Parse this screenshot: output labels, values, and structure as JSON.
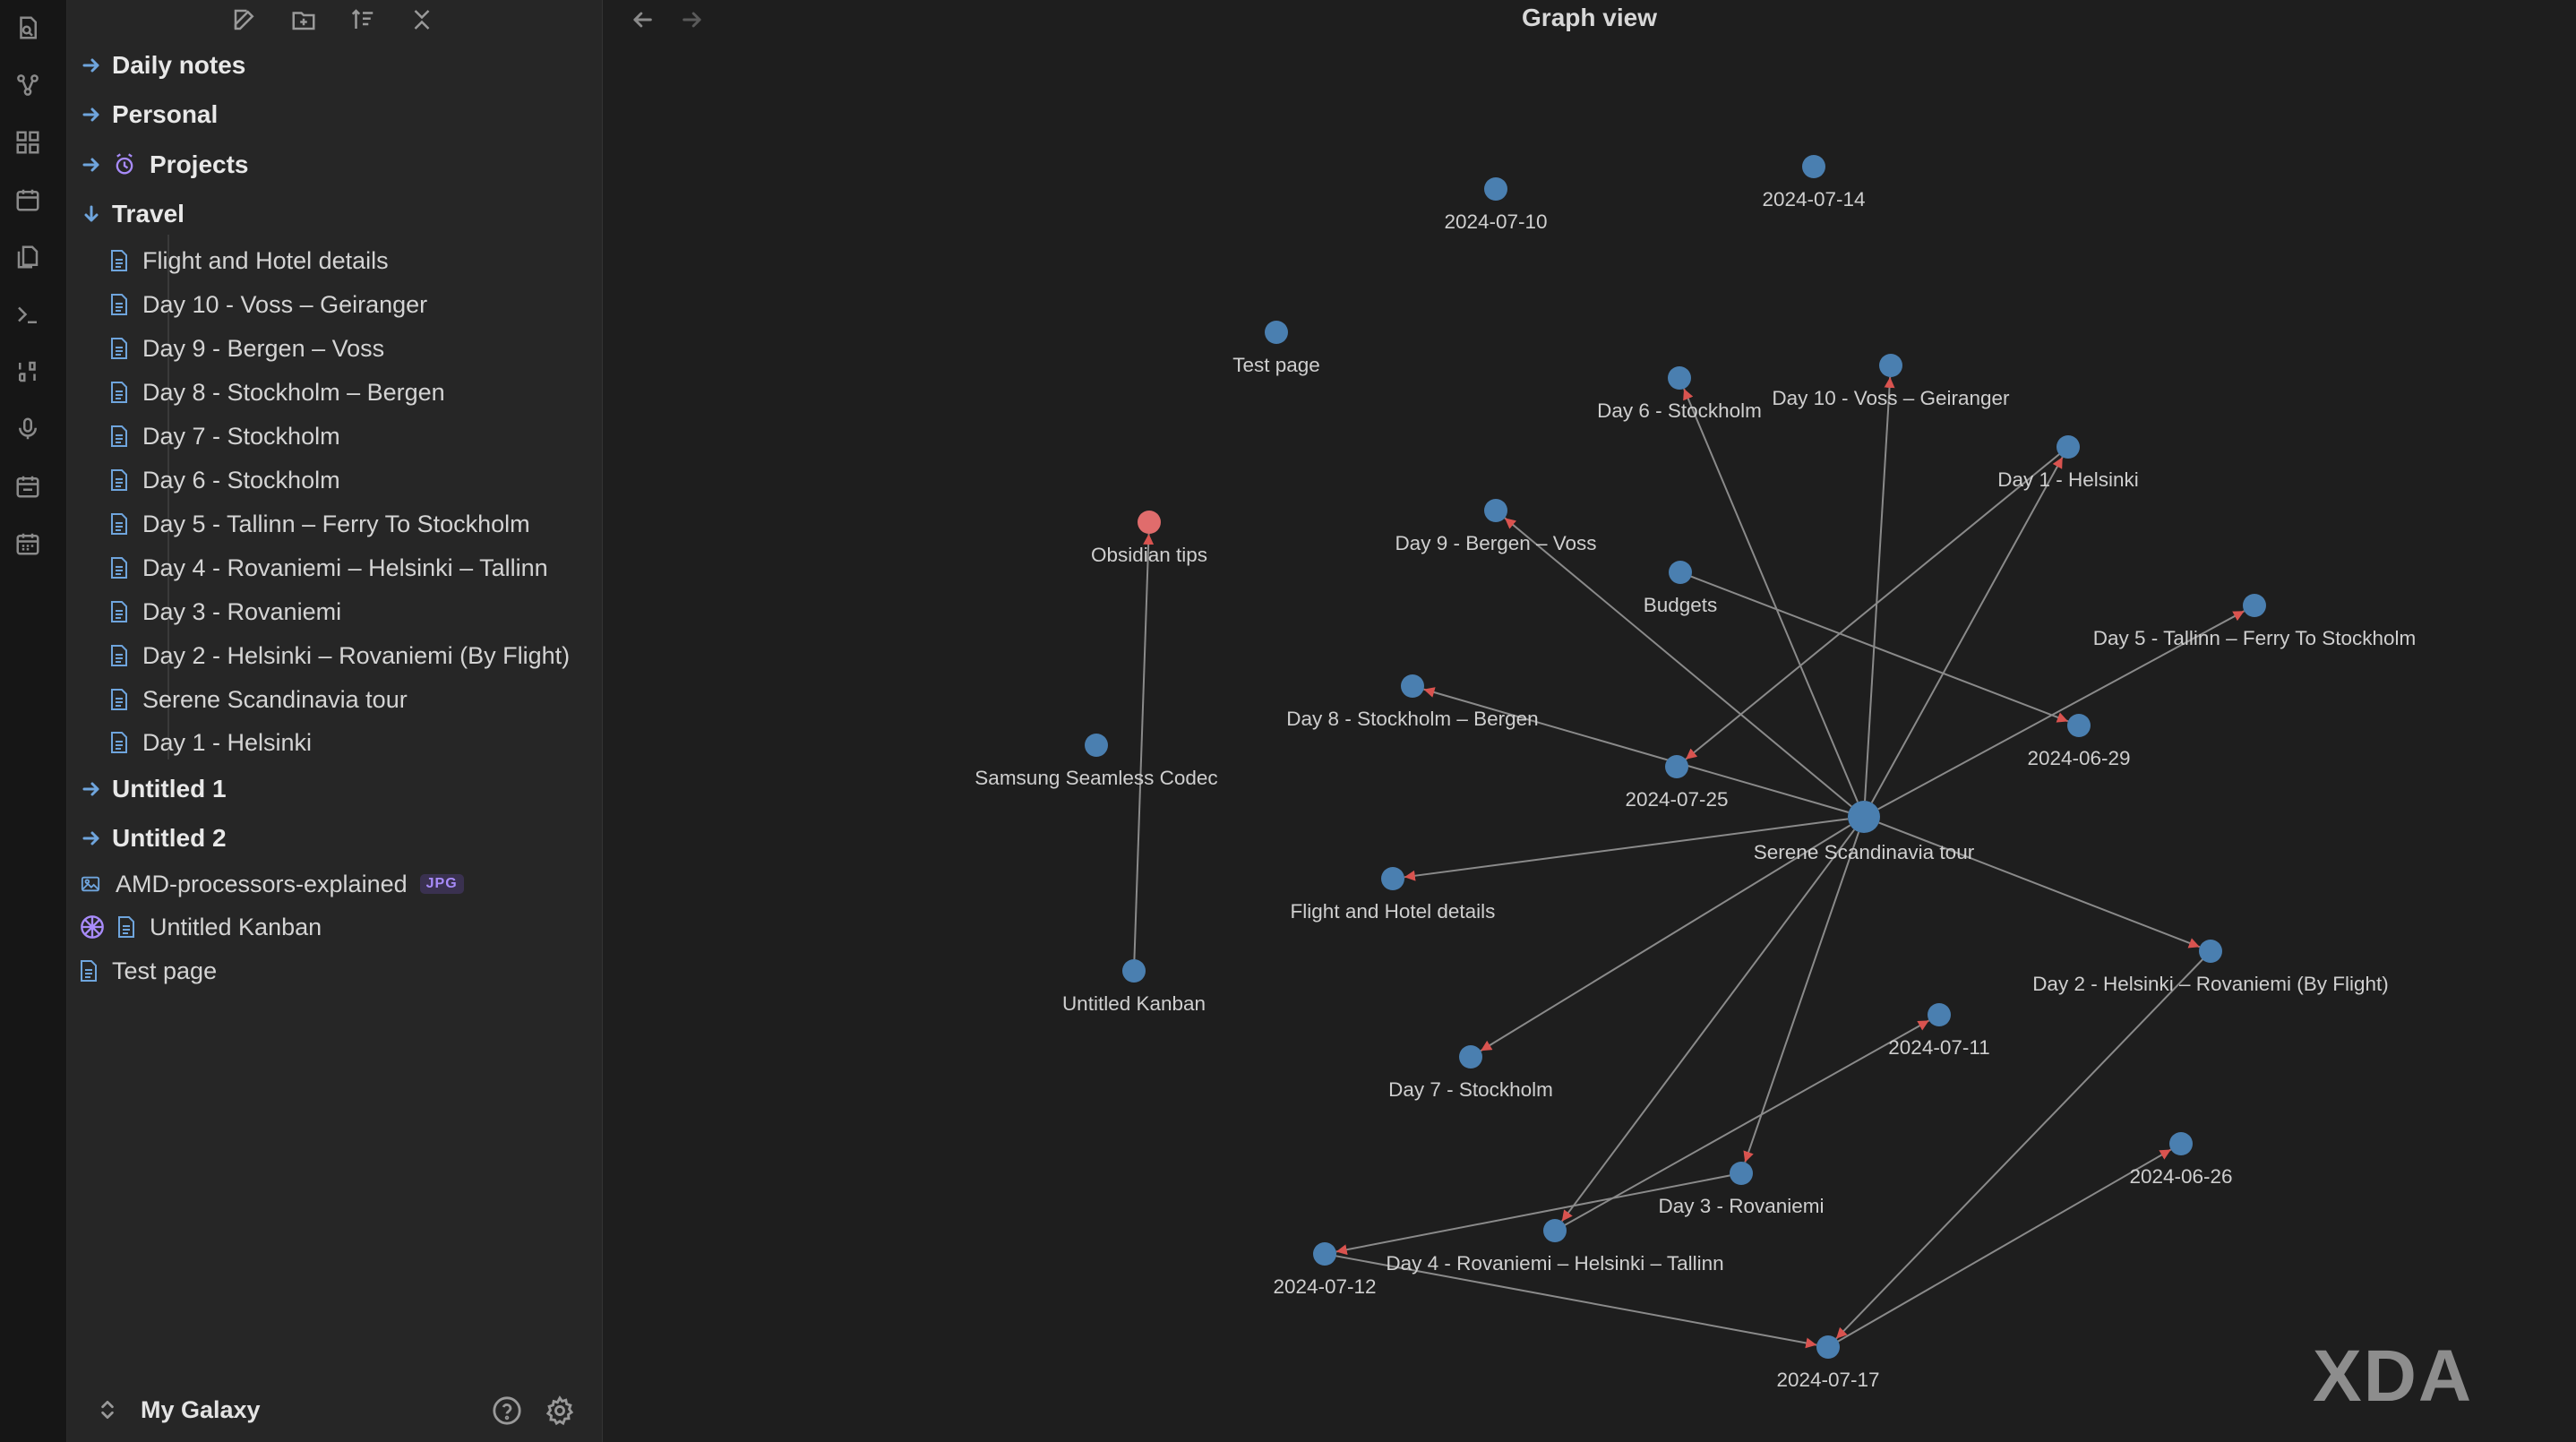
{
  "ribbon": {
    "icons": [
      "open-quick-switcher-icon",
      "graph-icon",
      "canvas-icon",
      "calendar-icon",
      "files-icon",
      "terminal-icon",
      "command-icon",
      "microphone-icon",
      "daily-note-icon",
      "calendar-grid-icon"
    ]
  },
  "sidebar": {
    "folders": {
      "daily_notes": "Daily notes",
      "personal": "Personal",
      "projects": "Projects",
      "travel": "Travel",
      "untitled1": "Untitled 1",
      "untitled2": "Untitled 2"
    },
    "travel_files": [
      "Flight and Hotel details",
      "Day 10 - Voss – Geiranger",
      "Day 9 - Bergen – Voss",
      "Day 8 - Stockholm – Bergen",
      "Day 7 - Stockholm",
      "Day 6 - Stockholm",
      "Day 5 - Tallinn – Ferry To Stockholm",
      "Day 4 - Rovaniemi – Helsinki – Tallinn",
      "Day 3 - Rovaniemi",
      "Day 2 - Helsinki – Rovaniemi (By Flight)",
      "Serene Scandinavia tour",
      "Day 1 - Helsinki"
    ],
    "root_files": {
      "amd": "AMD-processors-explained",
      "amd_badge": "JPG",
      "kanban": "Untitled Kanban",
      "test_page": "Test page"
    },
    "vault_name": "My Galaxy"
  },
  "main": {
    "title": "Graph view"
  },
  "graph": {
    "node_color": "#4a7fb0",
    "active_node_color": "#e06c6c",
    "edge_color": "#8a8a8a",
    "arrow_color": "#d9534f",
    "nodes": [
      {
        "id": "n0710",
        "label": "2024-07-10"
      },
      {
        "id": "n0714",
        "label": "2024-07-14"
      },
      {
        "id": "ntest",
        "label": "Test page"
      },
      {
        "id": "nd6",
        "label": "Day 6 - Stockholm"
      },
      {
        "id": "nd10",
        "label": "Day 10 - Voss – Geiranger"
      },
      {
        "id": "nd1",
        "label": "Day 1 - Helsinki"
      },
      {
        "id": "nobs",
        "label": "Obsidian tips",
        "active": true
      },
      {
        "id": "nd9",
        "label": "Day 9 - Bergen – Voss"
      },
      {
        "id": "nbud",
        "label": "Budgets"
      },
      {
        "id": "nd5",
        "label": "Day 5 - Tallinn – Ferry To Stockholm"
      },
      {
        "id": "nd8",
        "label": "Day 8 - Stockholm – Bergen"
      },
      {
        "id": "n0629",
        "label": "2024-06-29"
      },
      {
        "id": "nsam",
        "label": "Samsung Seamless Codec"
      },
      {
        "id": "n0725",
        "label": "2024-07-25"
      },
      {
        "id": "nser",
        "label": "Serene Scandinavia tour",
        "hub": true
      },
      {
        "id": "nfli",
        "label": "Flight and Hotel details"
      },
      {
        "id": "nd2",
        "label": "Day 2 - Helsinki – Rovaniemi (By Flight)"
      },
      {
        "id": "nkan",
        "label": "Untitled Kanban"
      },
      {
        "id": "n0711",
        "label": "2024-07-11"
      },
      {
        "id": "nd7",
        "label": "Day 7 - Stockholm"
      },
      {
        "id": "n0626",
        "label": "2024-06-26"
      },
      {
        "id": "nd3",
        "label": "Day 3 - Rovaniemi"
      },
      {
        "id": "nd4",
        "label": "Day 4 - Rovaniemi – Helsinki – Tallinn"
      },
      {
        "id": "n0712",
        "label": "2024-07-12"
      },
      {
        "id": "n0717",
        "label": "2024-07-17"
      }
    ],
    "edges": [
      [
        "nser",
        "nd6"
      ],
      [
        "nser",
        "nd10"
      ],
      [
        "nser",
        "nd1"
      ],
      [
        "nser",
        "nd9"
      ],
      [
        "nser",
        "nd5"
      ],
      [
        "nser",
        "nd8"
      ],
      [
        "nser",
        "nfli"
      ],
      [
        "nser",
        "nd2"
      ],
      [
        "nser",
        "nd7"
      ],
      [
        "nser",
        "nd3"
      ],
      [
        "nser",
        "nd4"
      ],
      [
        "nbud",
        "n0629"
      ],
      [
        "nd1",
        "n0725"
      ],
      [
        "nkan",
        "nobs"
      ],
      [
        "nd4",
        "n0711"
      ],
      [
        "nd3",
        "n0712"
      ],
      [
        "n0712",
        "n0717"
      ],
      [
        "nd2",
        "n0717"
      ],
      [
        "n0717",
        "n0626"
      ]
    ]
  },
  "watermark": "XDA"
}
